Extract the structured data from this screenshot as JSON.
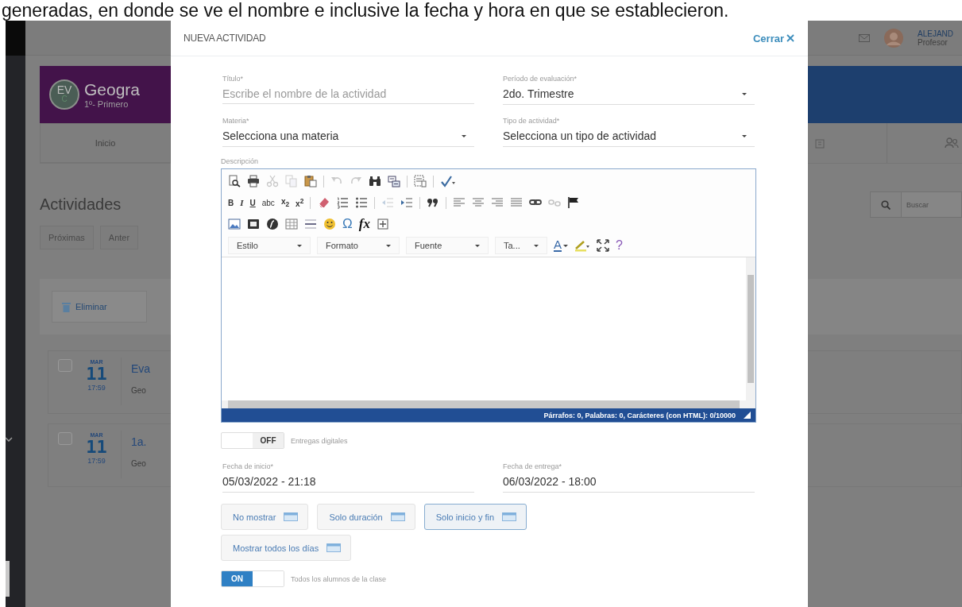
{
  "caption": "generadas, en donde se ve el nombre e inclusive la fecha y hora en que se establecieron.",
  "app": {
    "user": {
      "name": "ALEJAND",
      "role": "Profesor"
    },
    "course": {
      "badge": "EV",
      "badge_sub": "C",
      "title": "Geogra",
      "subtitle": "1º- Primero"
    },
    "nav_tab": "Inicio",
    "section_title": "Actividades",
    "search": {
      "placeholder": "Buscar"
    },
    "tabs": [
      "Próximas",
      "Anter"
    ],
    "delete_button": "Eliminar",
    "activities": [
      {
        "checked": false,
        "month": "MAR",
        "day": "11",
        "time": "17:59",
        "title": "Eva",
        "subtitle": "Geo"
      },
      {
        "checked": false,
        "month": "MAR",
        "day": "11",
        "time": "17:59",
        "title": "1a.",
        "subtitle": "Geo"
      }
    ]
  },
  "modal": {
    "title": "NUEVA ACTIVIDAD",
    "close": "Cerrar",
    "fields": [
      {
        "kind": "text",
        "label": "Título*",
        "placeholder": "Escribe el nombre de la actividad"
      },
      {
        "kind": "select",
        "label": "Período de evaluación*",
        "value": "2do. Trimestre"
      },
      {
        "kind": "select",
        "label": "Materia*",
        "value": "Selecciona una materia"
      },
      {
        "kind": "select",
        "label": "Tipo de actividad*",
        "value": "Selecciona un tipo de actividad"
      }
    ],
    "description": {
      "label": "Descripción",
      "toolbar": [
        [
          {
            "kind": "icon",
            "disabled": false
          },
          {
            "kind": "icon",
            "disabled": false
          },
          {
            "kind": "icon",
            "disabled": true
          },
          {
            "kind": "icon",
            "disabled": true
          },
          {
            "kind": "icon",
            "disabled": false
          },
          {
            "kind": "sep"
          },
          {
            "kind": "icon",
            "disabled": true
          },
          {
            "kind": "icon",
            "disabled": true
          },
          {
            "kind": "icon",
            "disabled": false
          },
          {
            "kind": "icon",
            "disabled": false
          },
          {
            "kind": "sep"
          },
          {
            "kind": "icon",
            "disabled": false
          },
          {
            "kind": "sep"
          },
          {
            "kind": "icon",
            "disabled": false
          }
        ],
        [
          {
            "kind": "glyph",
            "text": "B",
            "disabled": false
          },
          {
            "kind": "glyph",
            "text": "I",
            "disabled": false
          },
          {
            "kind": "glyph",
            "text": "U",
            "disabled": false
          },
          {
            "kind": "glyph",
            "text": "abc",
            "disabled": false
          },
          {
            "kind": "glyph",
            "text": "x$_{2}$",
            "disabled": false
          },
          {
            "kind": "glyph",
            "text": "x$^{2}$",
            "disabled": false
          },
          {
            "kind": "sep"
          },
          {
            "kind": "icon",
            "disabled": false
          },
          {
            "kind": "icon",
            "disabled": false
          },
          {
            "kind": "icon",
            "disabled": false
          },
          {
            "kind": "sep"
          },
          {
            "kind": "icon",
            "disabled": true
          },
          {
            "kind": "icon",
            "disabled": false
          },
          {
            "kind": "sep"
          },
          {
            "kind": "icon",
            "disabled": false
          },
          {
            "kind": "sep"
          },
          {
            "kind": "icon",
            "disabled": false
          },
          {
            "kind": "icon",
            "disabled": false
          },
          {
            "kind": "icon",
            "disabled": false
          },
          {
            "kind": "icon",
            "disabled": false
          },
          {
            "kind": "icon",
            "disabled": false
          },
          {
            "kind": "icon",
            "disabled": true
          },
          {
            "kind": "icon",
            "disabled": false
          }
        ],
        [
          {
            "kind": "icon",
            "disabled": false
          },
          {
            "kind": "icon",
            "disabled": false
          },
          {
            "kind": "icon",
            "disabled": false
          },
          {
            "kind": "icon",
            "disabled": false
          },
          {
            "kind": "icon",
            "disabled": false
          },
          {
            "kind": "icon",
            "disabled": false
          },
          {
            "kind": "glyph",
            "text": "Ω",
            "disabled": false
          },
          {
            "kind": "glyph",
            "text": "fx",
            "disabled": false
          },
          {
            "kind": "icon",
            "disabled": false
          }
        ],
        [
          {
            "kind": "combo",
            "text": "Estilo"
          },
          {
            "kind": "combo",
            "text": "Formato"
          },
          {
            "kind": "combo",
            "text": "Fuente"
          },
          {
            "kind": "combo",
            "text": "Ta..."
          },
          {
            "kind": "glyph",
            "text": "A",
            "disabled": false
          },
          {
            "kind": "icon",
            "disabled": false
          },
          {
            "kind": "icon",
            "disabled": false
          },
          {
            "kind": "glyph",
            "text": "?",
            "disabled": false
          }
        ]
      ],
      "status": "Párrafos: 0, Palabras: 0, Carácteres (con HTML): 0/10000"
    },
    "digital_toggle": {
      "on": false,
      "text": "OFF",
      "label": "Entregas digitales"
    },
    "date_fields": [
      {
        "label": "Fecha de inicio*",
        "value": "05/03/2022 - 21:18"
      },
      {
        "label": "Fecha de entrega*",
        "value": "06/03/2022 - 18:00"
      }
    ],
    "display_options": [
      {
        "label": "No mostrar",
        "selected": false
      },
      {
        "label": "Solo duración",
        "selected": false
      },
      {
        "label": "Solo inicio y fin",
        "selected": true
      },
      {
        "label": "Mostrar todos los días",
        "selected": false
      }
    ],
    "students_toggle": {
      "on": true,
      "text": "ON",
      "label": "Todos los alumnos de la clase"
    }
  }
}
